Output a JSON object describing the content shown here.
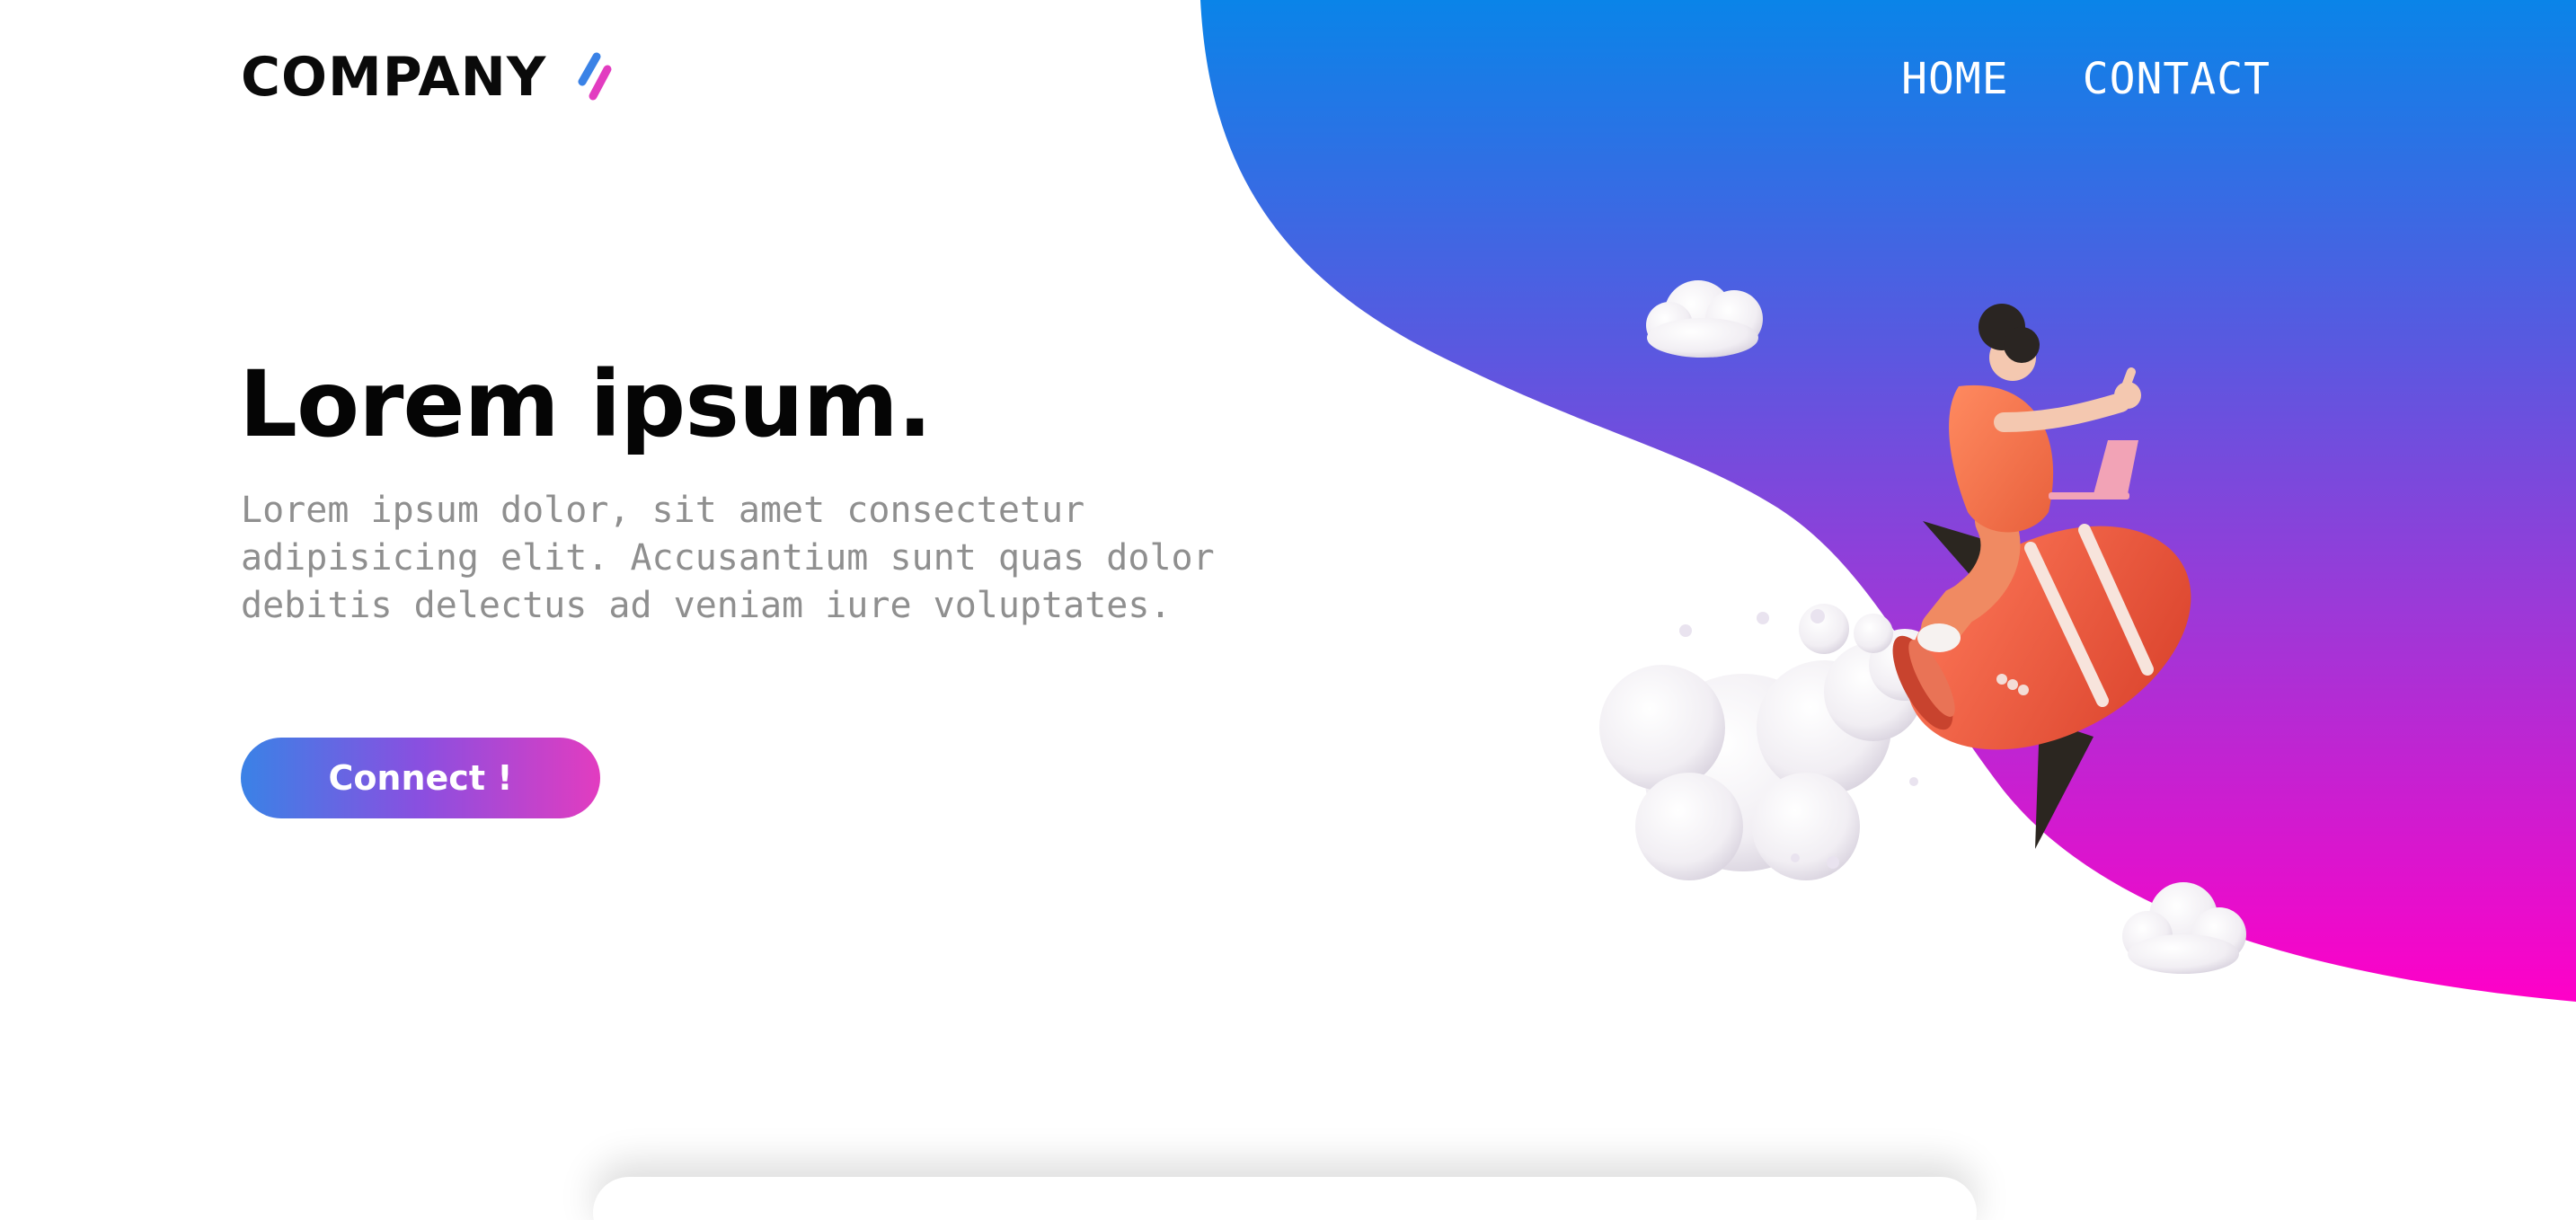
{
  "header": {
    "logo_text": "COMPANY",
    "nav": [
      {
        "label": "HOME"
      },
      {
        "label": "CONTACT"
      }
    ]
  },
  "hero": {
    "title": "Lorem ipsum.",
    "body": "Lorem ipsum dolor, sit amet consectetur adipisicing elit. Accusantium sunt quas dolor debitis delectus ad veniam iure voluptates.",
    "cta_label": "Connect !"
  },
  "colors": {
    "gradient_top": "#0a84e8",
    "gradient_mid": "#7a45dd",
    "gradient_bottom": "#f806c8",
    "logo_mark_blue": "#3a82e6",
    "logo_mark_pink": "#e23cc0",
    "title": "#050505",
    "body": "#8f8f8f"
  },
  "icons": {
    "logo_mark": "double-slash-icon",
    "illustration": "rocket-rider-illustration"
  }
}
